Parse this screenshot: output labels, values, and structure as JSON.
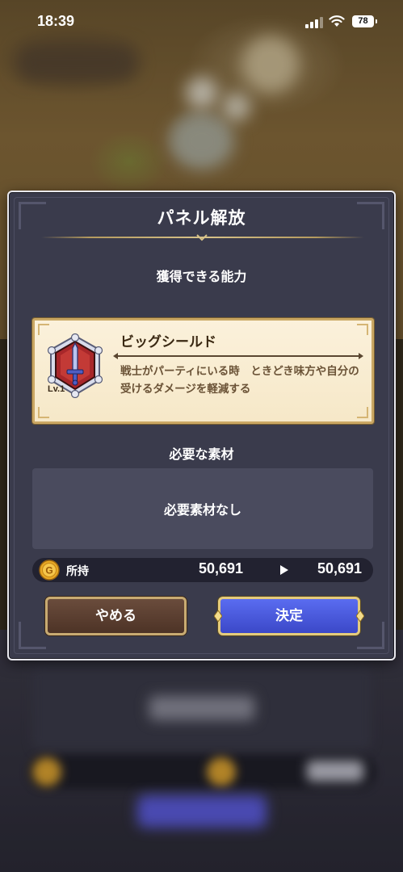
{
  "status_bar": {
    "time": "18:39",
    "battery": "78",
    "icons": [
      "signal-icon",
      "wifi-icon",
      "battery-icon"
    ]
  },
  "dialog": {
    "title": "パネル解放",
    "ability_heading": "獲得できる能力",
    "ability": {
      "name": "ビッグシールド",
      "level": "Lv.1",
      "icon": "sword-shield-icon",
      "description": "戦士がパーティにいる時　ときどき味方や自分の受けるダメージを軽減する"
    },
    "materials_heading": "必要な素材",
    "materials_text": "必要素材なし",
    "currency": {
      "icon": "gold-coin-icon",
      "label": "所持",
      "before": "50,691",
      "after": "50,691"
    },
    "buttons": {
      "cancel": "やめる",
      "confirm": "決定"
    }
  },
  "colors": {
    "dialog_bg": "#3a3b4c",
    "card_bg": "#fbf1db",
    "confirm_button": "#4a5ae0",
    "cancel_button": "#5a3e30",
    "gold_border": "#caa763"
  }
}
